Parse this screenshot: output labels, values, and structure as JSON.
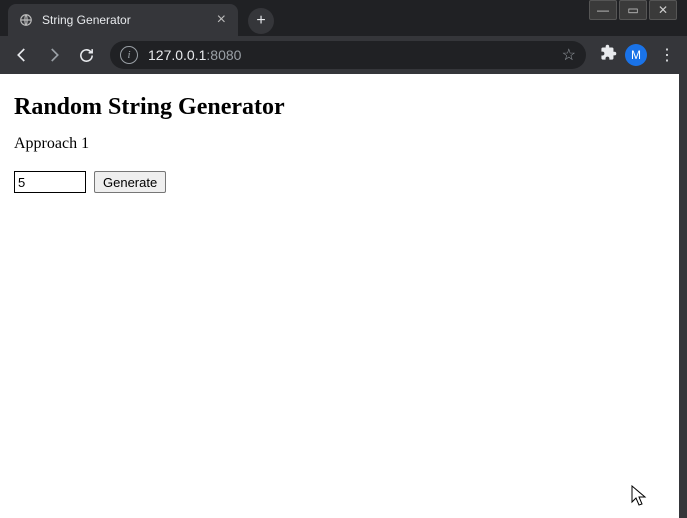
{
  "window_controls": {
    "minimize": "—",
    "maximize": "▭",
    "close": "✕"
  },
  "browser": {
    "tab_title": "String Generator",
    "address_host": "127.0.0.1",
    "address_port": ":8080",
    "avatar_initial": "M"
  },
  "page": {
    "heading": "Random String Generator",
    "subheading": "Approach 1",
    "input_value": "5",
    "generate_label": "Generate"
  }
}
